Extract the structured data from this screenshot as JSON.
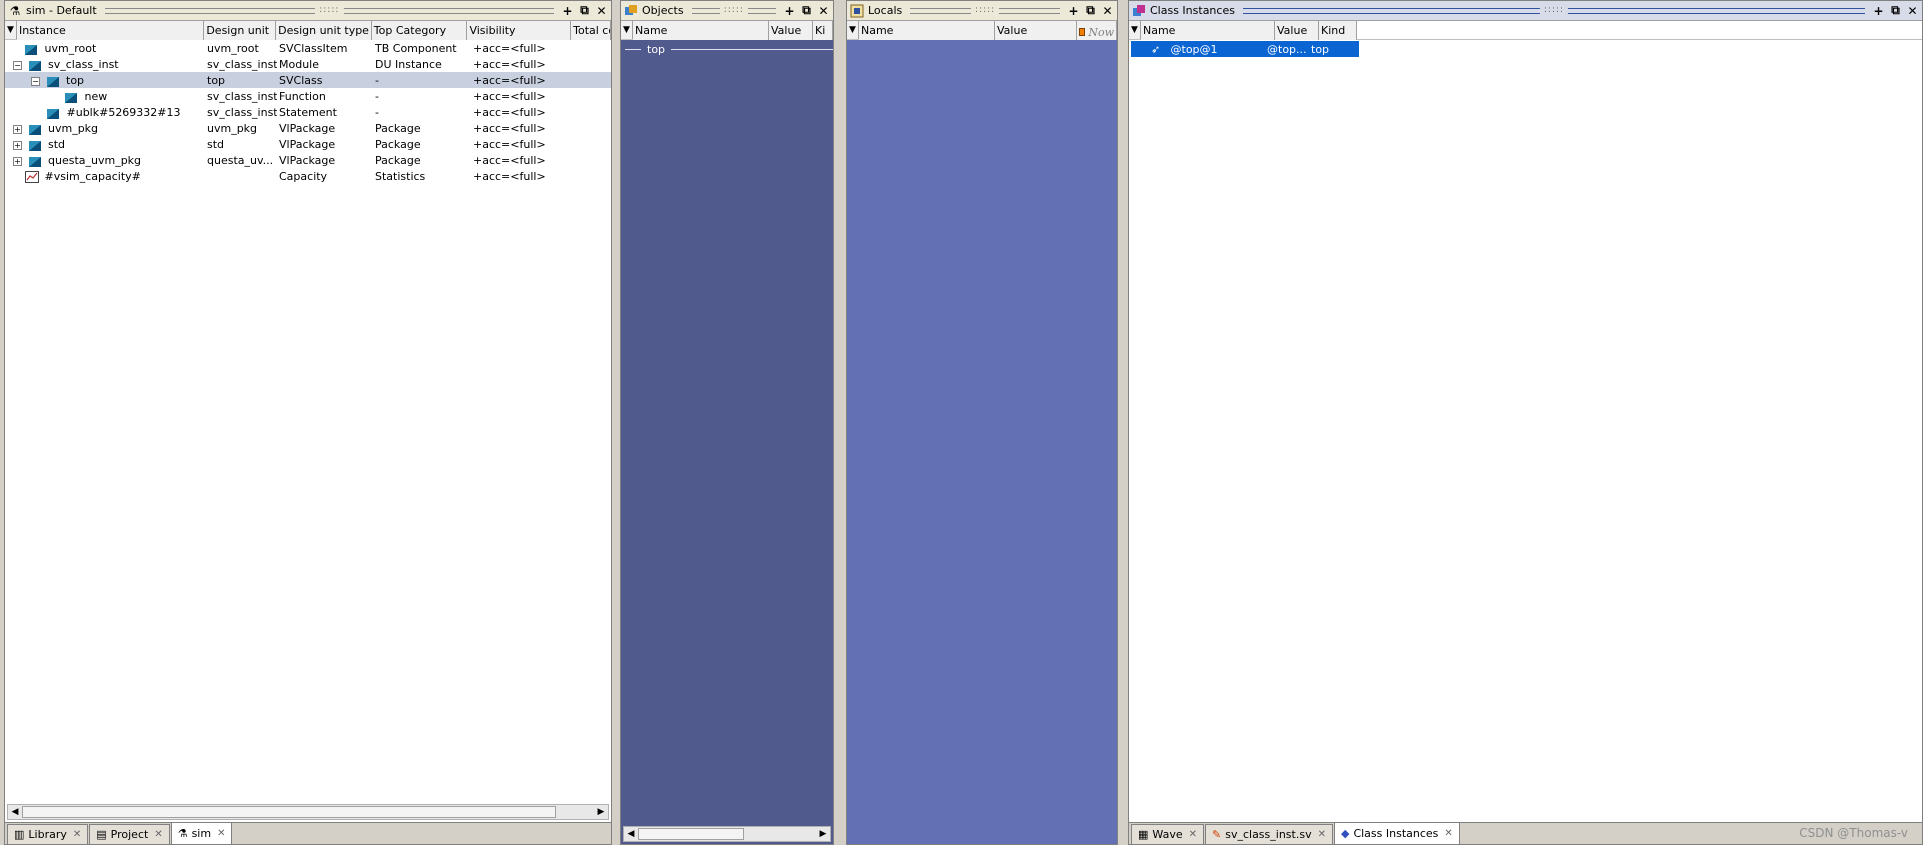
{
  "sim_pane": {
    "title": "sim - Default",
    "columns": [
      "Instance",
      "Design unit",
      "Design unit type",
      "Top Category",
      "Visibility",
      "Total co"
    ],
    "rows": [
      {
        "instance": "uvm_root",
        "design_unit": "uvm_root",
        "du_type": "SVClassItem",
        "category": "TB Component",
        "visibility": "+acc=<full>"
      },
      {
        "instance": "sv_class_inst",
        "design_unit": "sv_class_inst",
        "du_type": "Module",
        "category": "DU Instance",
        "visibility": "+acc=<full>"
      },
      {
        "instance": "top",
        "design_unit": "top",
        "du_type": "SVClass",
        "category": "-",
        "visibility": "+acc=<full>"
      },
      {
        "instance": "new",
        "design_unit": "sv_class_inst",
        "du_type": "Function",
        "category": "-",
        "visibility": "+acc=<full>"
      },
      {
        "instance": "#ublk#5269332#13",
        "design_unit": "sv_class_inst",
        "du_type": "Statement",
        "category": "-",
        "visibility": "+acc=<full>"
      },
      {
        "instance": "uvm_pkg",
        "design_unit": "uvm_pkg",
        "du_type": "VlPackage",
        "category": "Package",
        "visibility": "+acc=<full>"
      },
      {
        "instance": "std",
        "design_unit": "std",
        "du_type": "VlPackage",
        "category": "Package",
        "visibility": "+acc=<full>"
      },
      {
        "instance": "questa_uvm_pkg",
        "design_unit": "questa_uv...",
        "du_type": "VlPackage",
        "category": "Package",
        "visibility": "+acc=<full>"
      },
      {
        "instance": "#vsim_capacity#",
        "design_unit": "",
        "du_type": "Capacity",
        "category": "Statistics",
        "visibility": "+acc=<full>"
      }
    ],
    "tabs": [
      "Library",
      "Project",
      "sim"
    ]
  },
  "objects_pane": {
    "title": "Objects",
    "columns": [
      "Name",
      "Value",
      "Ki"
    ],
    "top_label": "top"
  },
  "locals_pane": {
    "title": "Locals",
    "columns": [
      "Name",
      "Value"
    ],
    "now_label": "Now"
  },
  "class_pane": {
    "title": "Class Instances",
    "columns": [
      "Name",
      "Value",
      "Kind"
    ],
    "row": {
      "name": "@top@1",
      "value": "@top...",
      "kind": "top"
    },
    "tabs": [
      "Wave",
      "sv_class_inst.sv",
      "Class Instances"
    ]
  },
  "watermark": "CSDN @Thomas-v",
  "colors": {
    "objects_bg": "#505a8c",
    "locals_bg": "#6470b4",
    "selection": "#0a64d2",
    "row_selected": "#c8d0e0"
  }
}
